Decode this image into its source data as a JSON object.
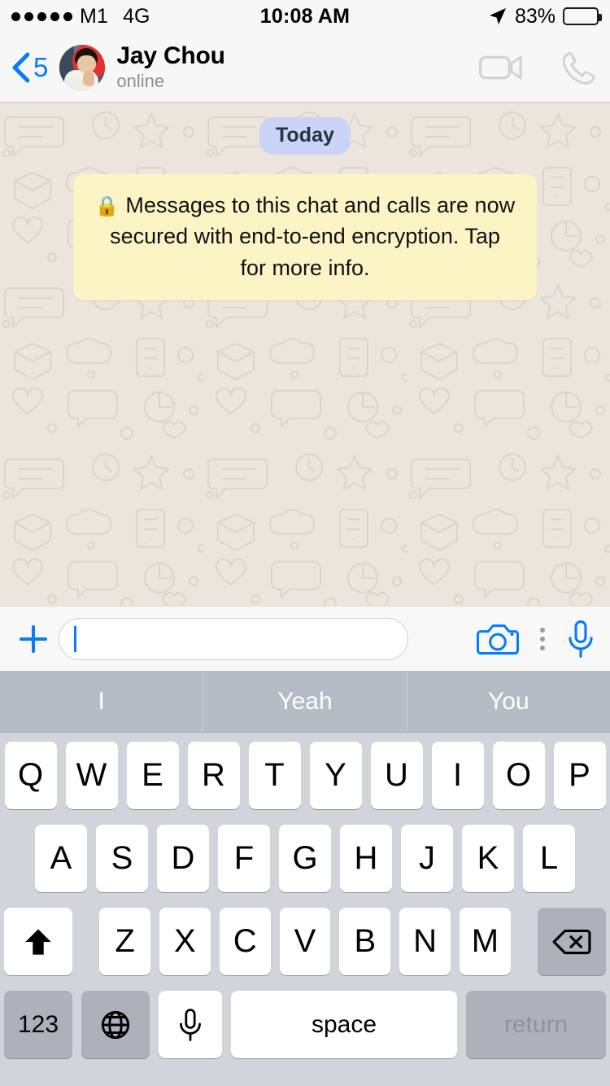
{
  "status_bar": {
    "signal_dots": 5,
    "carrier": "M1",
    "network": "4G",
    "time": "10:08 AM",
    "battery_percent": "83%",
    "battery_level": 83,
    "battery_color": "#ffcc00",
    "location_icon": "location-arrow-icon"
  },
  "header": {
    "back_count": "5",
    "back_icon": "chevron-left-icon",
    "contact_name": "Jay Chou",
    "contact_status": "online",
    "avatar_icon": "contact-avatar",
    "video_call_icon": "video-camera-icon",
    "voice_call_icon": "phone-icon",
    "action_color": "#d3d3d5"
  },
  "chat": {
    "day_divider": "Today",
    "day_pill_color": "#c9d4f7",
    "encryption_lock_icon": "lock-icon",
    "encryption_notice": "Messages to this chat and calls are now secured with end-to-end encryption. Tap for more info.",
    "encryption_bubble_color": "#fdf4c6",
    "wallpaper_color": "#ebe5dd",
    "wallpaper_doodle_color": "#ded5ca"
  },
  "input_bar": {
    "attach_icon": "plus-icon",
    "message_value": "",
    "message_placeholder": "",
    "camera_icon": "camera-icon",
    "more_icon": "more-vertical-icon",
    "mic_icon": "microphone-icon",
    "accent_color": "#067cf9"
  },
  "predictive": {
    "suggestions": [
      "I",
      "Yeah",
      "You"
    ],
    "background_color": "#b6bcc6"
  },
  "keyboard": {
    "background_color": "#d1d4da",
    "row1": [
      "Q",
      "W",
      "E",
      "R",
      "T",
      "Y",
      "U",
      "I",
      "O",
      "P"
    ],
    "row2": [
      "A",
      "S",
      "D",
      "F",
      "G",
      "H",
      "J",
      "K",
      "L"
    ],
    "row3_letters": [
      "Z",
      "X",
      "C",
      "V",
      "B",
      "N",
      "M"
    ],
    "shift_icon": "shift-arrow-icon",
    "backspace_icon": "backspace-delete-icon",
    "numbers_key": "123",
    "globe_icon": "globe-icon",
    "dictation_icon": "microphone-icon",
    "space_key": "space",
    "return_key": "return"
  }
}
